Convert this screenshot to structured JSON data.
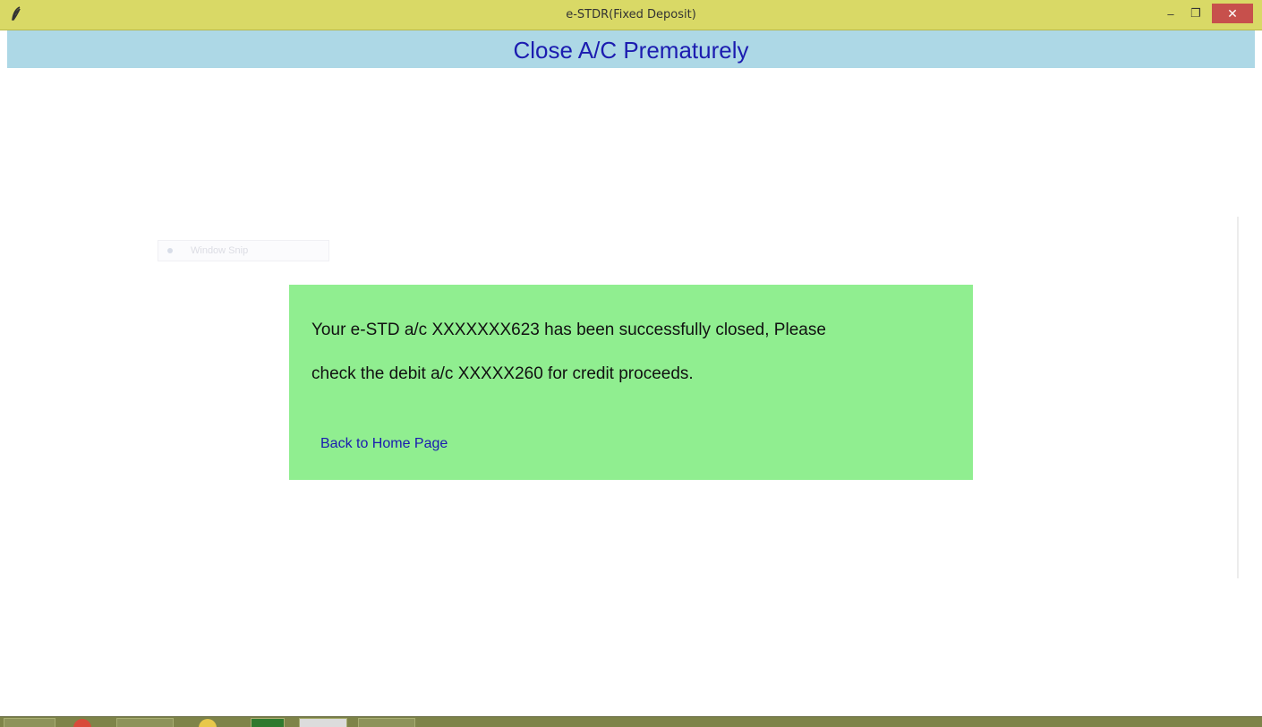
{
  "window": {
    "title": "e-STDR(Fixed Deposit)",
    "icon": "feather-icon",
    "controls": {
      "minimize": "–",
      "restore": "❐",
      "close": "✕"
    }
  },
  "header": {
    "title": "Close A/C Prematurely"
  },
  "message": {
    "line1": "Your e-STD a/c XXXXXXX623 has been successfully closed, Please",
    "line2": "check the debit a/c XXXXX260 for credit proceeds.",
    "link": "Back to Home Page"
  },
  "overlay": {
    "snip_label": "Window Snip"
  },
  "colors": {
    "titlebar": "#d9d966",
    "header_bg": "#add8e6",
    "header_text": "#1c1cb0",
    "panel_bg": "#90ee90",
    "link": "#1a1ab0",
    "close_button": "#c7504c",
    "taskbar": "#7e8449"
  }
}
